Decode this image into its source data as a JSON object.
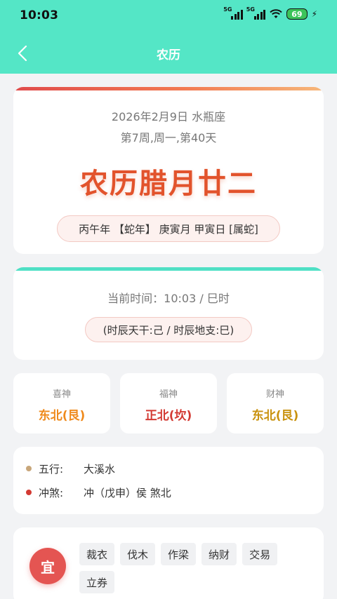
{
  "status": {
    "time": "10:03",
    "net1": "5G",
    "net2": "5G",
    "battery": "69"
  },
  "nav": {
    "title": "农历",
    "back_icon": "chevron-left-icon"
  },
  "main_card": {
    "date": "2026年2月9日 水瓶座",
    "week": "第7周,周一,第40天",
    "lunar": "农历腊月廿二",
    "ganzhi": "丙午年 【蛇年】 庚寅月 甲寅日 [属蛇]"
  },
  "time_card": {
    "current": "当前时间：10:03 / 巳时",
    "shichen": "(时辰天干:己 / 时辰地支:巳)"
  },
  "gods": [
    {
      "title": "喜神",
      "value": "东北(艮)",
      "color": "#ef8a1c"
    },
    {
      "title": "福神",
      "value": "正北(坎)",
      "color": "#d33a33"
    },
    {
      "title": "财神",
      "value": "东北(艮)",
      "color": "#c9920e"
    }
  ],
  "info": [
    {
      "label": "五行:",
      "value": "大溪水",
      "dot_color": "#c8a67a"
    },
    {
      "label": "冲煞:",
      "value": "冲（戊申）侯 煞北",
      "dot_color": "#d33a33"
    }
  ],
  "yi": {
    "badge": "宜",
    "tags": [
      "裁衣",
      "伐木",
      "作梁",
      "纳财",
      "交易",
      "立券"
    ]
  },
  "colors": {
    "header": "#54e6c6",
    "accent_red": "#e2532c"
  }
}
